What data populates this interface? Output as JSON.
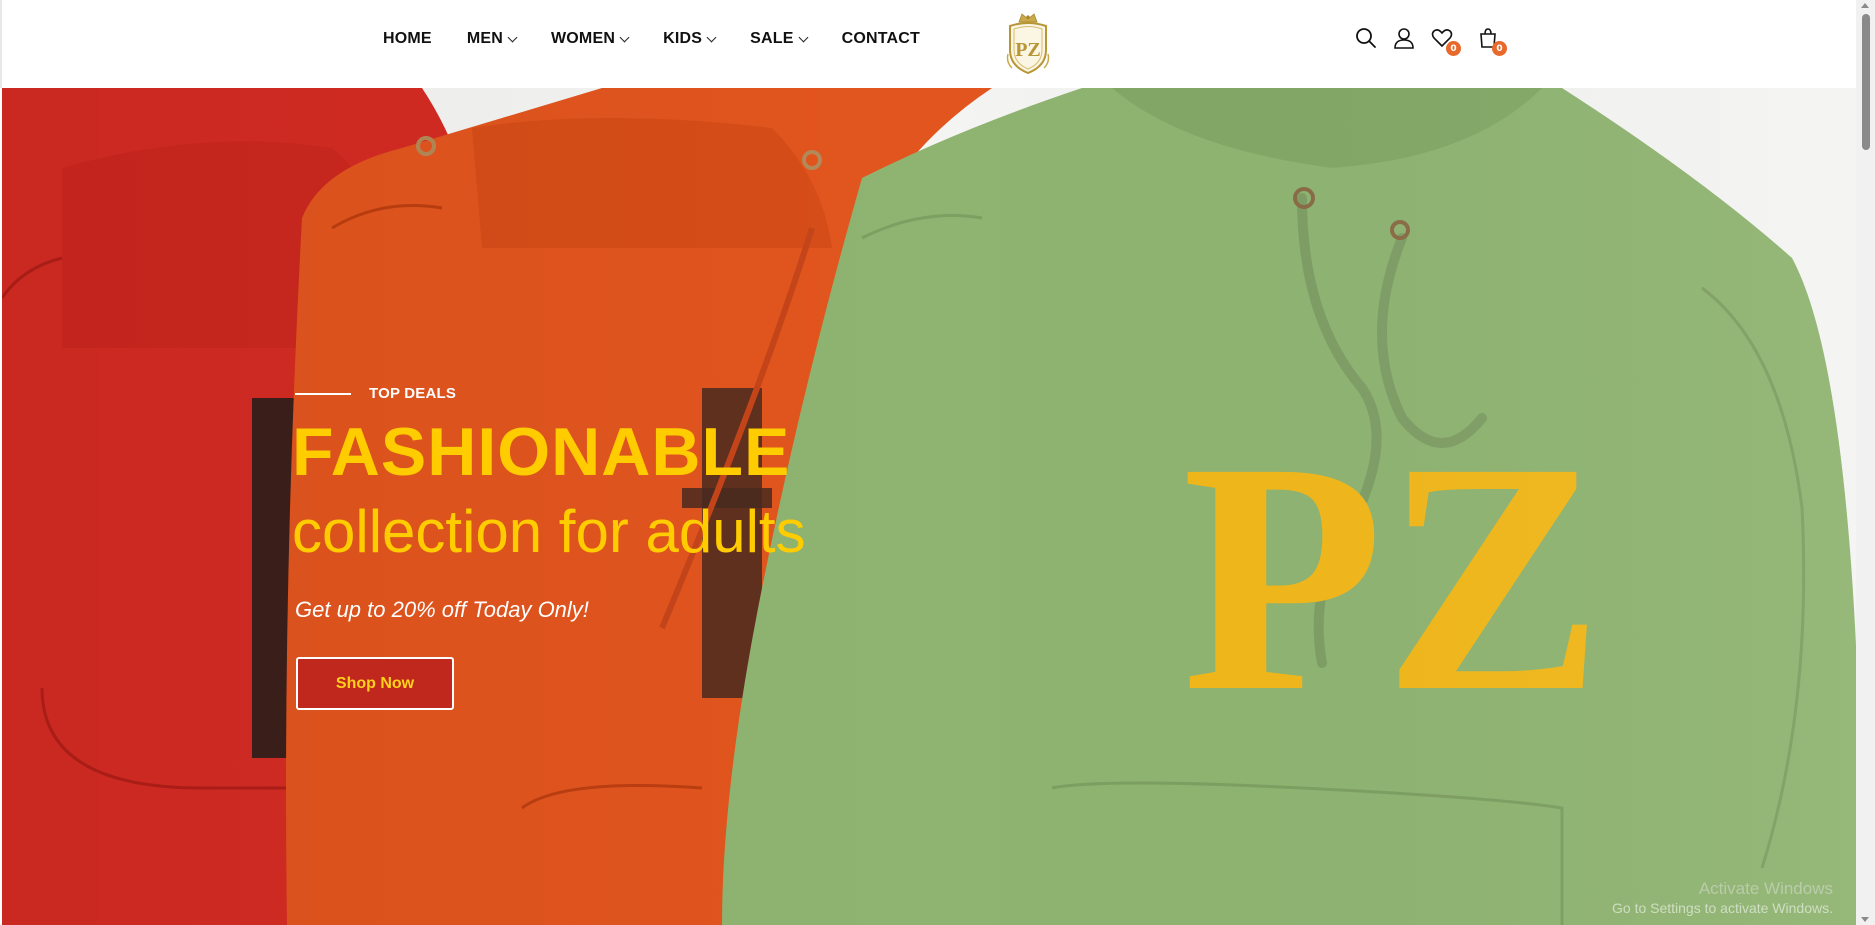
{
  "nav": {
    "items": [
      {
        "label": "HOME",
        "has_dropdown": false
      },
      {
        "label": "MEN",
        "has_dropdown": true
      },
      {
        "label": "WOMEN",
        "has_dropdown": true
      },
      {
        "label": "KIDS",
        "has_dropdown": true
      },
      {
        "label": "SALE",
        "has_dropdown": true
      },
      {
        "label": "CONTACT",
        "has_dropdown": false
      }
    ]
  },
  "logo": {
    "text": "PZ",
    "icon": "crown-crest-logo"
  },
  "header_icons": {
    "search": {
      "icon": "search-icon"
    },
    "account": {
      "icon": "user-icon"
    },
    "wishlist": {
      "icon": "heart-icon",
      "count": "0"
    },
    "cart": {
      "icon": "shopping-bag-icon",
      "count": "0"
    }
  },
  "hero": {
    "eyebrow": "TOP DEALS",
    "headline": "FASHIONABLE",
    "subheadline": "collection for adults",
    "tagline": "Get up to 20% off Today Only!",
    "cta_label": "Shop Now",
    "product_print": "PZ"
  },
  "watermark": {
    "line1": "Activate Windows",
    "line2": "Go to Settings to activate Windows."
  },
  "colors": {
    "accent_yellow": "#ffcc00",
    "cta_red": "#c0281e",
    "badge_orange": "#e8692c",
    "hoodie_red": "#d42b23",
    "hoodie_orange": "#e2551e",
    "hoodie_green": "#8fb471"
  }
}
